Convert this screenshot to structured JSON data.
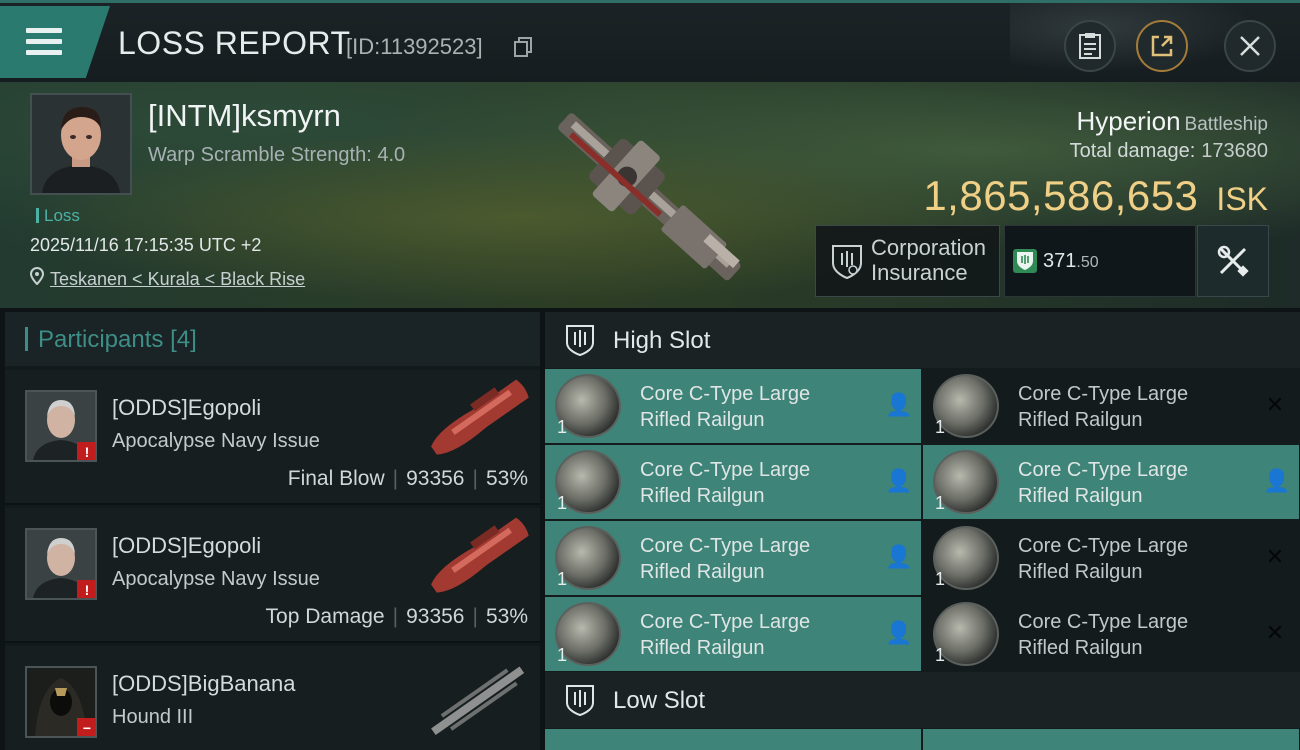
{
  "header": {
    "title": "LOSS REPORT",
    "report_id": "[ID:11392523]"
  },
  "victim": {
    "name": "[INTM]ksmyrn",
    "warp_scramble": "Warp Scramble Strength: 4.0",
    "status": "Loss",
    "time": "2025/11/16 17:15:35 UTC +2",
    "location": "Teskanen < Kurala < Black Rise"
  },
  "ship": {
    "name": "Hyperion",
    "class": "Battleship",
    "total_damage_label": "Total damage:",
    "total_damage_value": "173680",
    "isk_value": "1,865,586,653",
    "isk_unit": "ISK"
  },
  "insurance": {
    "label_line1": "Corporation",
    "label_line2": "Insurance",
    "value_main": "371",
    "value_fraction": ".50"
  },
  "participants": {
    "title": "Participants",
    "count": "[4]",
    "rows": [
      {
        "name": "[ODDS]Egopoli",
        "ship": "Apocalypse Navy Issue",
        "tag": "Final Blow",
        "damage": "93356",
        "percent": "53%",
        "flag": "!"
      },
      {
        "name": "[ODDS]Egopoli",
        "ship": "Apocalypse Navy Issue",
        "tag": "Top Damage",
        "damage": "93356",
        "percent": "53%",
        "flag": "!"
      },
      {
        "name": "[ODDS]BigBanana",
        "ship": "Hound III",
        "flag": "−"
      }
    ]
  },
  "slots": {
    "high_title": "High Slot",
    "low_title": "Low Slot",
    "high_modules": [
      {
        "line1": "Core C-Type Large",
        "line2": "Rifled Railgun",
        "qty": "1",
        "state": "highlight"
      },
      {
        "line1": "Core C-Type Large",
        "line2": "Rifled Railgun",
        "qty": "1",
        "state": "destroyed"
      },
      {
        "line1": "Core C-Type Large",
        "line2": "Rifled Railgun",
        "qty": "1",
        "state": "highlight"
      },
      {
        "line1": "Core C-Type Large",
        "line2": "Rifled Railgun",
        "qty": "1",
        "state": "highlight"
      },
      {
        "line1": "Core C-Type Large",
        "line2": "Rifled Railgun",
        "qty": "1",
        "state": "highlight"
      },
      {
        "line1": "Core C-Type Large",
        "line2": "Rifled Railgun",
        "qty": "1",
        "state": "destroyed"
      },
      {
        "line1": "Core C-Type Large",
        "line2": "Rifled Railgun",
        "qty": "1",
        "state": "highlight"
      },
      {
        "line1": "Core C-Type Large",
        "line2": "Rifled Railgun",
        "qty": "1",
        "state": "destroyed"
      }
    ]
  },
  "icons": {
    "menu": "hamburger-menu-icon",
    "copy": "copy-icon",
    "clipboard": "clipboard-icon",
    "share": "share-icon",
    "close": "close-icon",
    "location": "location-pin-icon",
    "insurance": "shield-icon",
    "fitting": "tools-icon"
  },
  "colors": {
    "accent": "#3f8478",
    "isk": "#f0cf86",
    "loss": "#4bb2a6",
    "warning": "#c21d1d"
  }
}
